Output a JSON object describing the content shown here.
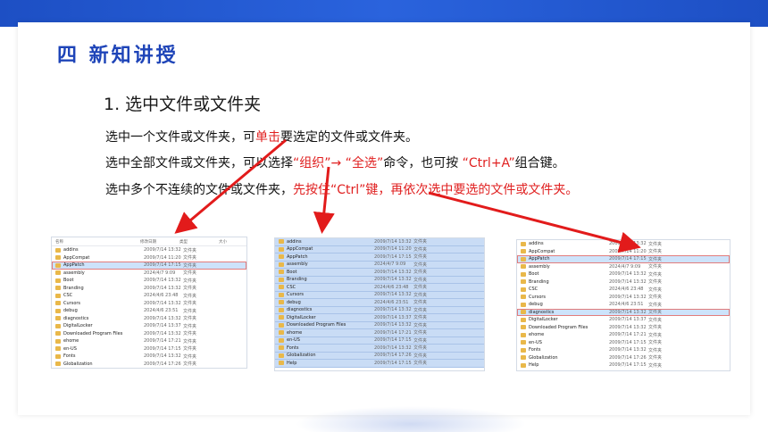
{
  "section_title": "四 新知讲授",
  "heading": "1. 选中文件或文件夹",
  "lines": {
    "l1": {
      "a": "选中一个文件或文件夹，可",
      "b": "单击",
      "c": "要选定的文件或文件夹。"
    },
    "l2": {
      "a": "选中全部文件或文件夹，可以选择",
      "b": "“组织”→ “全选”",
      "c": "命令，也可按 ",
      "d": "“Ctrl+A”",
      "e": "组合键。"
    },
    "l3": {
      "a": "选中多个不连续的文件或文件夹，",
      "b": "先按住“Ctrl”键，再依次选中要选的文件或文件夹。"
    }
  },
  "columns": {
    "name": "名称",
    "date": "修改日期",
    "type": "类型",
    "size": "大小"
  },
  "screenshot1": [
    {
      "name": "addins",
      "date": "2009/7/14 13:32",
      "type": "文件夹"
    },
    {
      "name": "AppCompat",
      "date": "2009/7/14 11:20",
      "type": "文件夹"
    },
    {
      "name": "AppPatch",
      "date": "2009/7/14 17:15",
      "type": "文件夹"
    },
    {
      "name": "assembly",
      "date": "2024/4/7 9:09",
      "type": "文件夹"
    },
    {
      "name": "Boot",
      "date": "2009/7/14 13:32",
      "type": "文件夹"
    },
    {
      "name": "Branding",
      "date": "2009/7/14 13:32",
      "type": "文件夹"
    },
    {
      "name": "CSC",
      "date": "2024/4/6 23:48",
      "type": "文件夹"
    },
    {
      "name": "Cursors",
      "date": "2009/7/14 13:32",
      "type": "文件夹"
    },
    {
      "name": "debug",
      "date": "2024/4/6 23:51",
      "type": "文件夹"
    },
    {
      "name": "diagnostics",
      "date": "2009/7/14 13:32",
      "type": "文件夹"
    },
    {
      "name": "DigitalLocker",
      "date": "2009/7/14 13:37",
      "type": "文件夹"
    },
    {
      "name": "Downloaded Program Files",
      "date": "2009/7/14 13:32",
      "type": "文件夹"
    },
    {
      "name": "ehome",
      "date": "2009/7/14 17:21",
      "type": "文件夹"
    },
    {
      "name": "en-US",
      "date": "2009/7/14 17:15",
      "type": "文件夹"
    },
    {
      "name": "Fonts",
      "date": "2009/7/14 13:32",
      "type": "文件夹"
    },
    {
      "name": "Globalization",
      "date": "2009/7/14 17:26",
      "type": "文件夹"
    },
    {
      "name": "Help",
      "date": "2009/7/14 17:15",
      "type": "文件夹"
    }
  ],
  "screenshot2": [
    {
      "name": "addins",
      "date": "2009/7/14 13:32",
      "type": "文件夹"
    },
    {
      "name": "AppCompat",
      "date": "2009/7/14 11:20",
      "type": "文件夹"
    },
    {
      "name": "AppPatch",
      "date": "2009/7/14 17:15",
      "type": "文件夹"
    },
    {
      "name": "assembly",
      "date": "2024/4/7 9:09",
      "type": "文件夹"
    },
    {
      "name": "Boot",
      "date": "2009/7/14 13:32",
      "type": "文件夹"
    },
    {
      "name": "Branding",
      "date": "2009/7/14 13:32",
      "type": "文件夹"
    },
    {
      "name": "CSC",
      "date": "2024/4/6 23:48",
      "type": "文件夹"
    },
    {
      "name": "Cursors",
      "date": "2009/7/14 13:32",
      "type": "文件夹"
    },
    {
      "name": "debug",
      "date": "2024/4/6 23:51",
      "type": "文件夹"
    },
    {
      "name": "diagnostics",
      "date": "2009/7/14 13:32",
      "type": "文件夹"
    },
    {
      "name": "DigitalLocker",
      "date": "2009/7/14 13:37",
      "type": "文件夹"
    },
    {
      "name": "Downloaded Program Files",
      "date": "2009/7/14 13:32",
      "type": "文件夹"
    },
    {
      "name": "ehome",
      "date": "2009/7/14 17:21",
      "type": "文件夹"
    },
    {
      "name": "en-US",
      "date": "2009/7/14 17:15",
      "type": "文件夹"
    },
    {
      "name": "Fonts",
      "date": "2009/7/14 13:32",
      "type": "文件夹"
    },
    {
      "name": "Globalization",
      "date": "2009/7/14 17:26",
      "type": "文件夹"
    },
    {
      "name": "Help",
      "date": "2009/7/14 17:15",
      "type": "文件夹"
    }
  ],
  "screenshot3": [
    {
      "name": "addins",
      "date": "2009/7/14 13:32",
      "type": "文件夹"
    },
    {
      "name": "AppCompat",
      "date": "2009/7/14 11:20",
      "type": "文件夹"
    },
    {
      "name": "AppPatch",
      "date": "2009/7/14 17:15",
      "type": "文件夹"
    },
    {
      "name": "assembly",
      "date": "2024/4/7 9:09",
      "type": "文件夹"
    },
    {
      "name": "Boot",
      "date": "2009/7/14 13:32",
      "type": "文件夹"
    },
    {
      "name": "Branding",
      "date": "2009/7/14 13:32",
      "type": "文件夹"
    },
    {
      "name": "CSC",
      "date": "2024/4/6 23:48",
      "type": "文件夹"
    },
    {
      "name": "Cursors",
      "date": "2009/7/14 13:32",
      "type": "文件夹"
    },
    {
      "name": "debug",
      "date": "2024/4/6 23:51",
      "type": "文件夹"
    },
    {
      "name": "diagnostics",
      "date": "2009/7/14 13:32",
      "type": "文件夹"
    },
    {
      "name": "DigitalLocker",
      "date": "2009/7/14 13:37",
      "type": "文件夹"
    },
    {
      "name": "Downloaded Program Files",
      "date": "2009/7/14 13:32",
      "type": "文件夹"
    },
    {
      "name": "ehome",
      "date": "2009/7/14 17:21",
      "type": "文件夹"
    },
    {
      "name": "en-US",
      "date": "2009/7/14 17:15",
      "type": "文件夹"
    },
    {
      "name": "Fonts",
      "date": "2009/7/14 13:32",
      "type": "文件夹"
    },
    {
      "name": "Globalization",
      "date": "2009/7/14 17:26",
      "type": "文件夹"
    },
    {
      "name": "Help",
      "date": "2009/7/14 17:15",
      "type": "文件夹"
    }
  ],
  "selected": {
    "screenshot1": [
      2
    ],
    "screenshot2": "all",
    "screenshot3": [
      2,
      9
    ]
  },
  "colors": {
    "accent": "#1e44b8",
    "highlight_red": "#e02020",
    "band": "#2a63dd"
  }
}
